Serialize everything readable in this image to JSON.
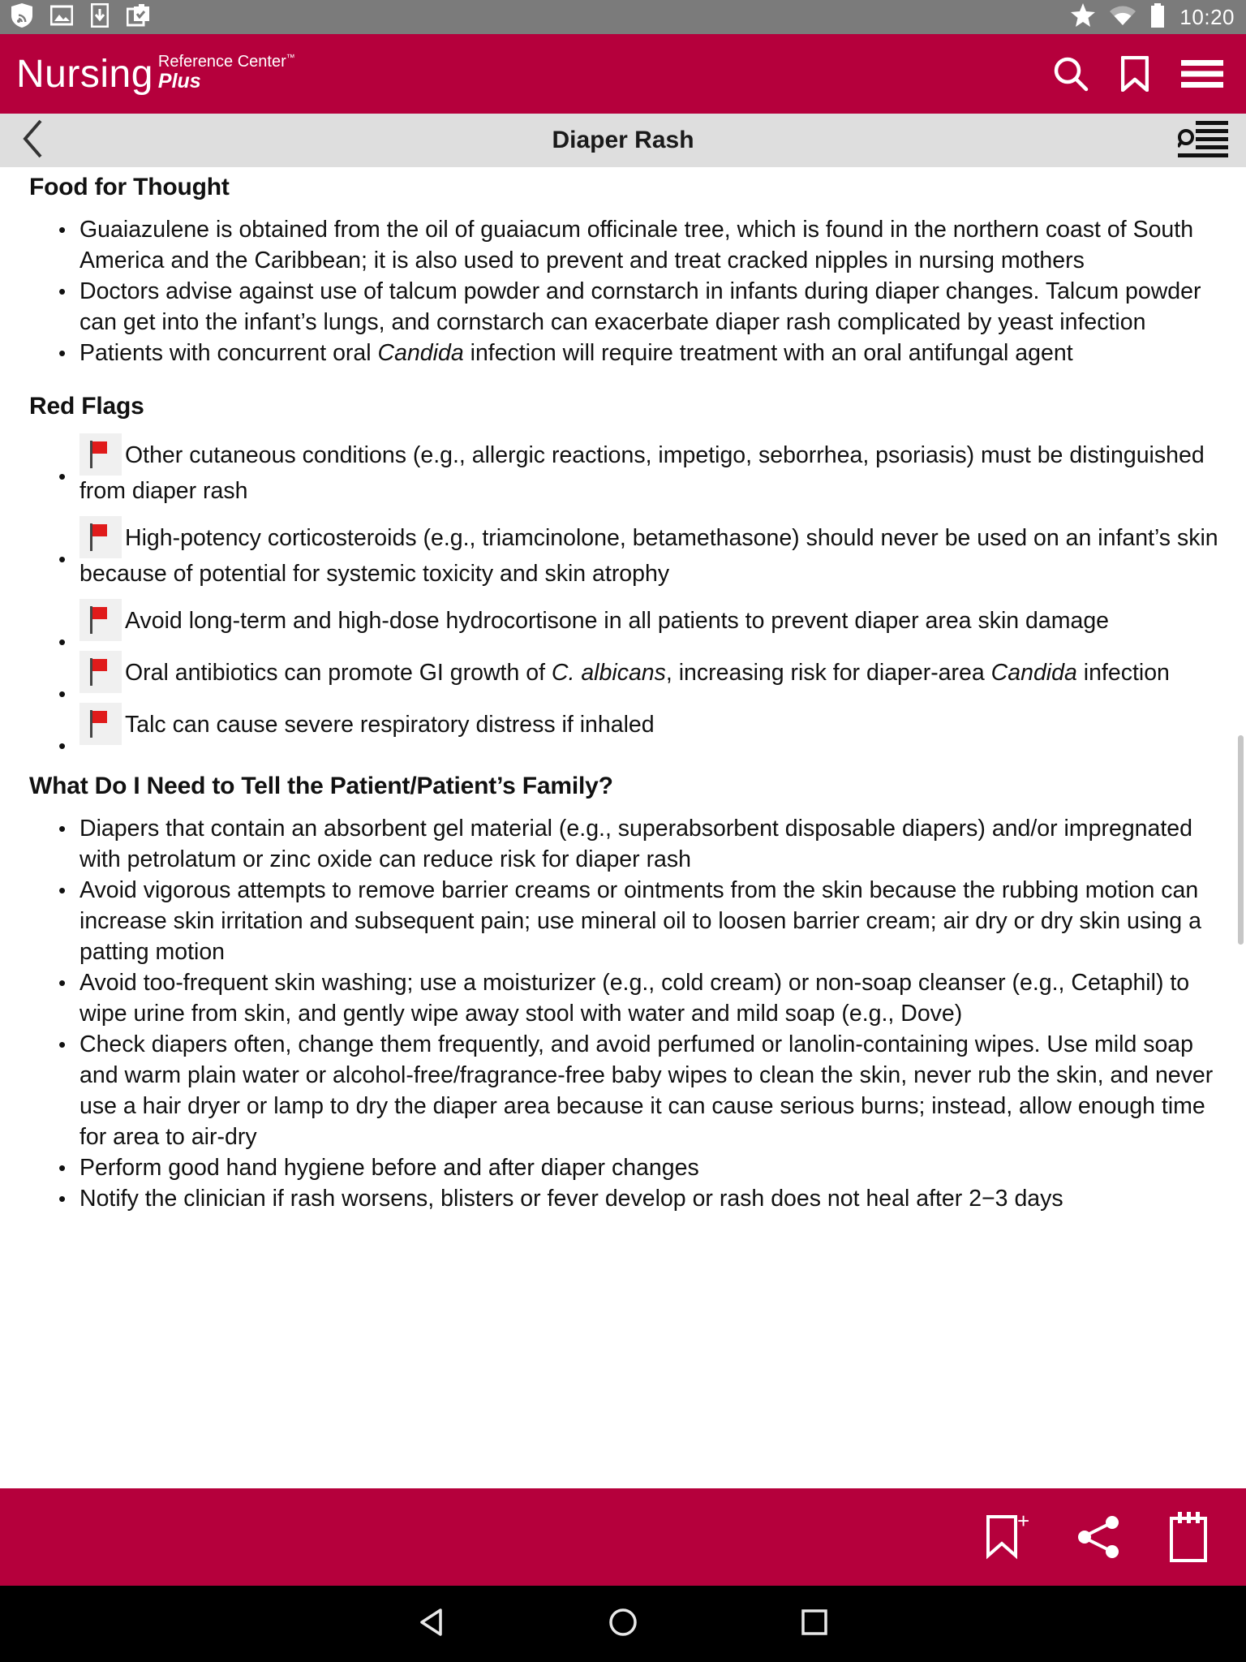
{
  "status_bar": {
    "time": "10:20",
    "left_icons": [
      "shield-signal-icon",
      "image-icon",
      "download-icon",
      "clipboard-check-icon"
    ],
    "right_icons": [
      "star-icon",
      "wifi-icon",
      "battery-icon"
    ]
  },
  "app_header": {
    "brand_main": "Nursing",
    "brand_reference_center": "Reference Center",
    "brand_trademark": "™",
    "brand_plus": "Plus",
    "actions": [
      "search-icon",
      "bookmark-icon",
      "menu-icon"
    ],
    "accent_color": "#b5003c"
  },
  "sub_header": {
    "title": "Diaper Rash",
    "back_label": "back-chevron-icon",
    "toc_label": "table-of-contents-icon",
    "background_color": "#dedede"
  },
  "article": {
    "sections": [
      {
        "heading": "Food for Thought",
        "items": [
          "Guaiazulene is obtained from the oil of guaiacum officinale tree, which is found in the northern coast of South America and the Caribbean; it is also used to prevent and treat cracked nipples in nursing mothers",
          "Doctors advise against use of talcum powder and cornstarch in infants during diaper changes. Talcum powder can get into the infant’s lungs, and cornstarch can exacerbate diaper rash complicated by yeast infection"
        ],
        "item_candida_prefix": "Patients with concurrent oral ",
        "item_candida_italic": "Candida",
        "item_candida_suffix": " infection will require treatment with an oral antifungal agent"
      },
      {
        "heading": "Red Flags",
        "flag_items": [
          "Other cutaneous conditions (e.g., allergic reactions, impetigo, seborrhea, psoriasis) must be distinguished from diaper rash",
          "High-potency corticosteroids (e.g., triamcinolone, betamethasone) should never be used on an infant’s skin because of potential for systemic toxicity and skin atrophy",
          "Avoid long-term and high-dose hydrocortisone in all patients to prevent diaper area skin damage"
        ],
        "flag_item_oral_a": "Oral antibiotics can promote GI growth of ",
        "flag_item_oral_italic1": "C. albicans",
        "flag_item_oral_b": ", increasing risk for diaper-area ",
        "flag_item_oral_italic2": "Candida",
        "flag_item_oral_c": " infection",
        "flag_item_last": "Talc can cause severe respiratory distress if inhaled"
      },
      {
        "heading": "What Do I Need to Tell the Patient/Patient’s Family?",
        "items": [
          "Diapers that contain an absorbent gel material (e.g., superabsorbent disposable diapers) and/or impregnated with petrolatum or zinc oxide can reduce risk for diaper rash",
          "Avoid vigorous attempts to remove barrier creams or ointments from the skin because the rubbing motion can increase skin irritation and subsequent pain; use mineral oil to loosen barrier cream; air dry or dry skin using a patting motion",
          "Avoid too-frequent skin washing; use a moisturizer (e.g., cold cream) or non-soap cleanser (e.g., Cetaphil) to wipe urine from skin, and gently wipe away stool with water and mild soap (e.g., Dove)",
          "Check diapers often, change them frequently, and avoid perfumed or lanolin-containing wipes. Use mild soap and warm plain water or alcohol-free/fragrance-free baby wipes to clean the skin, never rub the skin, and never use a hair dryer or lamp to dry the diaper area because it can cause serious burns; instead, allow enough time for area to air-dry",
          "Perform good hand hygiene before and after diaper changes",
          "Notify the clinician if rash worsens, blisters or fever develop or rash does not heal after 2−3 days"
        ]
      }
    ]
  },
  "bottom_bar": {
    "actions": [
      "add-bookmark-icon",
      "share-icon",
      "notepad-icon"
    ],
    "add_superscript": "+",
    "background_color": "#b5003c"
  },
  "android_nav": {
    "buttons": [
      "back-triangle-icon",
      "home-circle-icon",
      "recents-square-icon"
    ]
  }
}
